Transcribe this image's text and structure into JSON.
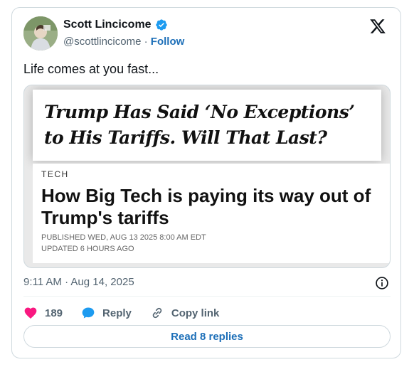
{
  "author": {
    "name": "Scott Lincicome",
    "handle": "@scottlincicome",
    "separator": "·",
    "follow_label": "Follow",
    "verified": true
  },
  "tweet": {
    "text": "Life comes at you fast..."
  },
  "media": {
    "nyt_headline": "Trump Has Said ‘No Exceptions’ to His Tariffs. Will That Last?",
    "section": "TECH",
    "article_title": "How Big Tech is paying its way out of Trump's tariffs",
    "published": "PUBLISHED WED, AUG 13 2025 8:00 AM EDT",
    "updated": "UPDATED 6 HOURS AGO"
  },
  "meta": {
    "timestamp": "9:11 AM · Aug 14, 2025"
  },
  "actions": {
    "likes": "189",
    "reply_label": "Reply",
    "copy_link_label": "Copy link"
  },
  "read_replies_label": "Read 8 replies",
  "colors": {
    "link_blue": "#1d6fb8",
    "like_pink": "#f91880",
    "verified_blue": "#1d9bf0",
    "muted": "#536471"
  },
  "icons": [
    "verified-badge-icon",
    "x-logo-icon",
    "info-icon",
    "heart-icon",
    "reply-bubble-icon",
    "link-icon"
  ]
}
